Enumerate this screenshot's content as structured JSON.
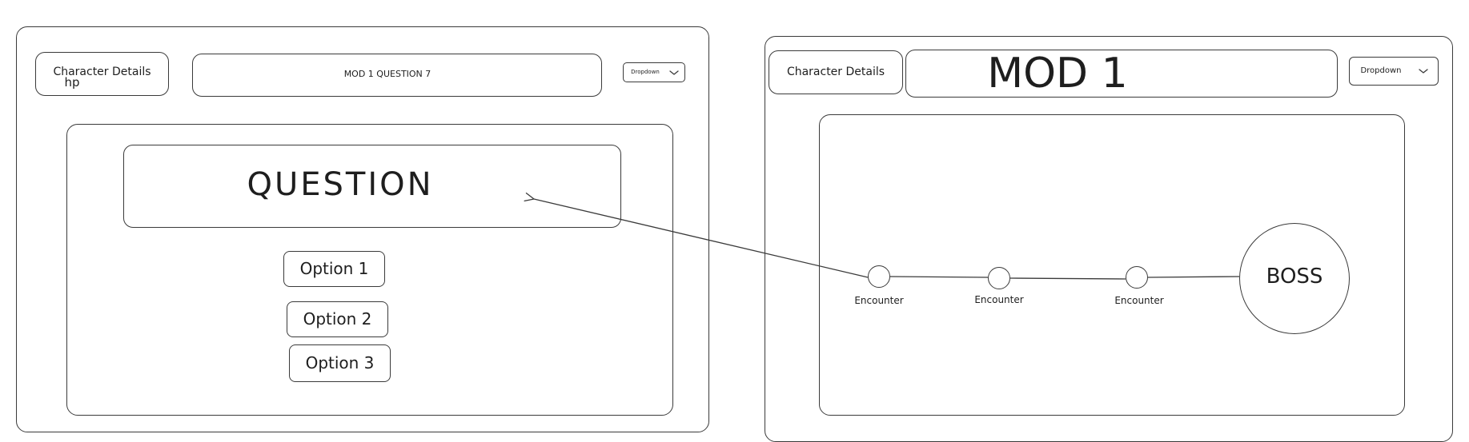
{
  "left_screen": {
    "character_details_label": "Character Details",
    "hp_label": "hp",
    "header_title": "MOD 1 QUESTION 7",
    "dropdown_label": "Dropdown",
    "question_label": "QUESTION",
    "options": [
      {
        "label": "Option 1"
      },
      {
        "label": "Option 2"
      },
      {
        "label": "Option 3"
      }
    ]
  },
  "right_screen": {
    "character_details_label": "Character Details",
    "header_title": "MOD 1",
    "dropdown_label": "Dropdown",
    "encounters": [
      {
        "label": "Encounter"
      },
      {
        "label": "Encounter"
      },
      {
        "label": "Encounter"
      }
    ],
    "boss_label": "BOSS"
  },
  "colors": {
    "stroke": "#3a3a3a",
    "text": "#1e1e1e",
    "background": "#ffffff"
  }
}
